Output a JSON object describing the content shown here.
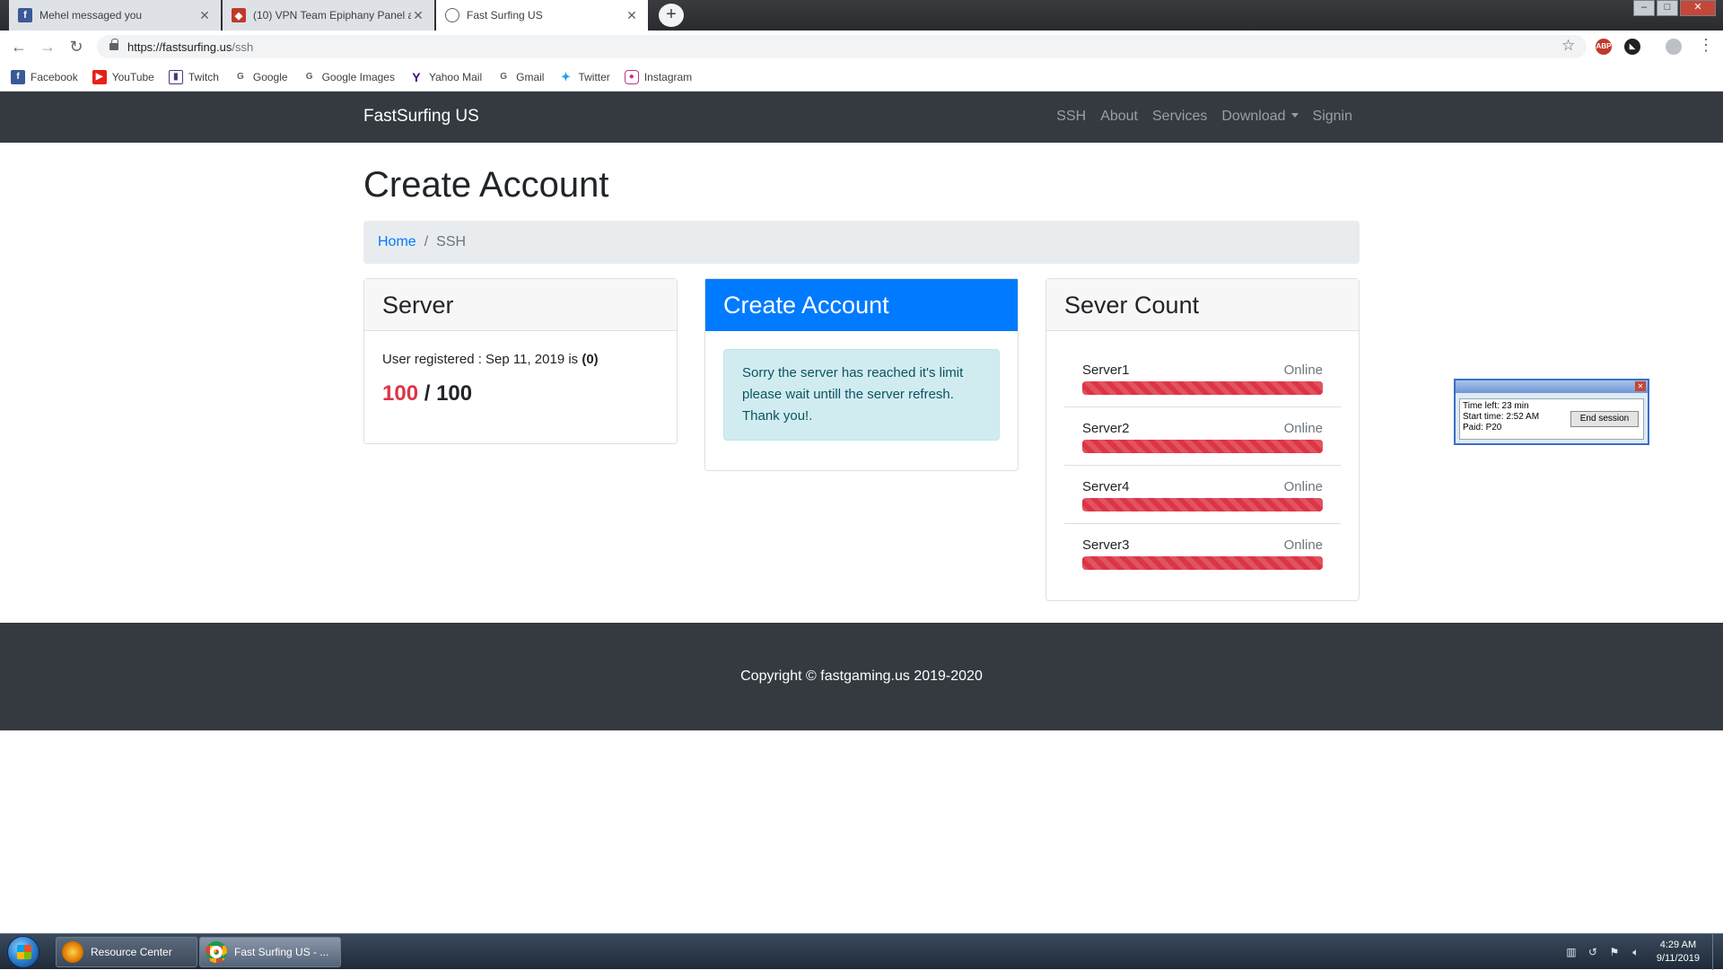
{
  "browser": {
    "tabs": [
      {
        "title": "Mehel messaged you",
        "icon": "facebook-icon",
        "color": "#3b5998"
      },
      {
        "title": "(10) VPN Team Epiphany Panel a",
        "icon": "shield-icon",
        "color": "#c0392b"
      },
      {
        "title": "Fast Surfing US",
        "icon": "globe-icon",
        "color": "#5f6368"
      }
    ],
    "url_host": "https://fastsurfing.us",
    "url_path": "/ssh",
    "bookmarks": [
      {
        "label": "Facebook",
        "icon": "facebook-icon",
        "color": "#3b5998"
      },
      {
        "label": "YouTube",
        "icon": "youtube-icon",
        "color": "#e62117"
      },
      {
        "label": "Twitch",
        "icon": "twitch-icon",
        "color": "#4b367c"
      },
      {
        "label": "Google",
        "icon": "google-icon",
        "color": "#4285f4"
      },
      {
        "label": "Google Images",
        "icon": "google-icon",
        "color": "#4285f4"
      },
      {
        "label": "Yahoo Mail",
        "icon": "yahoo-icon",
        "color": "#400090"
      },
      {
        "label": "Gmail",
        "icon": "google-icon",
        "color": "#4285f4"
      },
      {
        "label": "Twitter",
        "icon": "twitter-icon",
        "color": "#1da1f2"
      },
      {
        "label": "Instagram",
        "icon": "instagram-icon",
        "color": "#c13584"
      }
    ]
  },
  "site": {
    "brand": "FastSurfing US",
    "nav": [
      "SSH",
      "About",
      "Services",
      "Download",
      "Signin"
    ]
  },
  "page": {
    "title": "Create Account",
    "breadcrumb": {
      "home": "Home",
      "sep": "/",
      "current": "SSH"
    }
  },
  "server_card": {
    "header": "Server",
    "registered_text": "User registered : Sep 11, 2019 is ",
    "registered_count": "(0)",
    "used": "100",
    "sep": " / ",
    "limit": "100"
  },
  "create_card": {
    "header": "Create Account",
    "alert": "Sorry the server has reached it's limit please wait untill the server refresh. Thank you!."
  },
  "count_card": {
    "header": "Sever Count",
    "servers": [
      {
        "name": "Server1",
        "status": "Online",
        "load": 1.0
      },
      {
        "name": "Server2",
        "status": "Online",
        "load": 1.0
      },
      {
        "name": "Server4",
        "status": "Online",
        "load": 1.0
      },
      {
        "name": "Server3",
        "status": "Online",
        "load": 1.0
      }
    ]
  },
  "footer": {
    "text": "Copyright © fastgaming.us 2019-2020"
  },
  "timer": {
    "time_left": "Time left: 23 min",
    "start_time": "Start time: 2:52 AM",
    "paid": "Paid: P20",
    "end_button": "End session"
  },
  "taskbar": {
    "items": [
      "Resource Center",
      "Fast Surfing US - ..."
    ],
    "time": "4:29 AM",
    "date": "9/11/2019"
  },
  "colors": {
    "accent": "#007bff",
    "danger": "#dc3545",
    "navbar": "#343a40",
    "alert_bg": "#d1ecf1"
  }
}
